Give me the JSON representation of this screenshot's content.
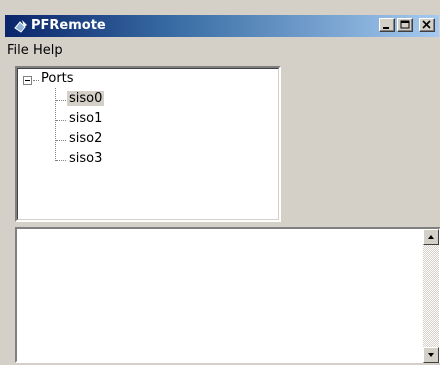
{
  "window": {
    "title": "PFRemote"
  },
  "menu": {
    "file": "File",
    "help": "Help"
  },
  "tree": {
    "root": "Ports",
    "children": [
      "siso0",
      "siso1",
      "siso2",
      "siso3"
    ],
    "selected": "siso0"
  },
  "colors": {
    "titlebar_start": "#0a246a",
    "titlebar_end": "#a6caf0",
    "face": "#d4d0c8"
  }
}
